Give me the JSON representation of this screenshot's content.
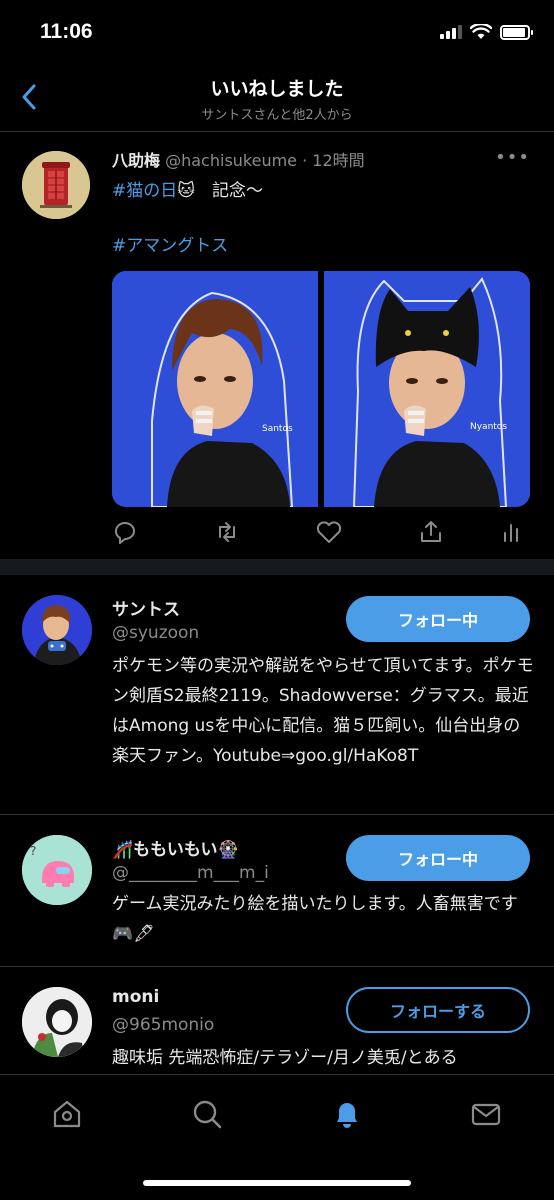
{
  "status_bar": {
    "time": "11:06",
    "battery_level": 0.9
  },
  "header": {
    "title": "いいねしました",
    "subtitle": "サントスさんと他2人から"
  },
  "tweet": {
    "author_name": "八助梅",
    "author_handle": "@hachisukeume",
    "separator": " · ",
    "time": "12時間",
    "hashtag_cat": "#猫の日",
    "emoji_cat": "🐱",
    "text_rest": "　記念〜",
    "hashtag_among": "#アマングトス",
    "media_signatures": [
      "Santos",
      "Nyantos"
    ],
    "actions": [
      "reply-icon",
      "retweet-icon",
      "like-icon",
      "share-icon",
      "analytics-icon"
    ]
  },
  "users": [
    {
      "name": "サントス",
      "handle": "@syuzoon",
      "bio": "ポケモン等の実況や解説をやらせて頂いてます。ポケモン剣盾S2最終2119。Shadowverse：グラマス。最近はAmong usを中心に配信。猫５匹飼い。仙台出身の楽天ファン。Youtube⇒goo.gl/HaKo8T",
      "follow_label": "フォロー中",
      "following": true
    },
    {
      "name": "🎢ももいもい🎡",
      "handle": "@________m___m_i",
      "bio": "ゲーム実況みたり絵を描いたりします。人畜無害です🎮🖋",
      "follow_label": "フォロー中",
      "following": true
    },
    {
      "name": "moni",
      "handle": "@965monio",
      "bio": "趣味垢 先端恐怖症/テラゾー/月ノ美兎/とある",
      "follow_label": "フォローする",
      "following": false
    }
  ],
  "tabbar": {
    "tabs": [
      "home-icon",
      "search-icon",
      "notifications-icon",
      "messages-icon"
    ],
    "active": "notifications-icon",
    "colors": {
      "active": "#4a9de6",
      "inactive": "#8b8b8b"
    }
  },
  "colors": {
    "accent": "#4a9de6",
    "background": "#000000",
    "secondary_text": "#8b8b8b"
  }
}
